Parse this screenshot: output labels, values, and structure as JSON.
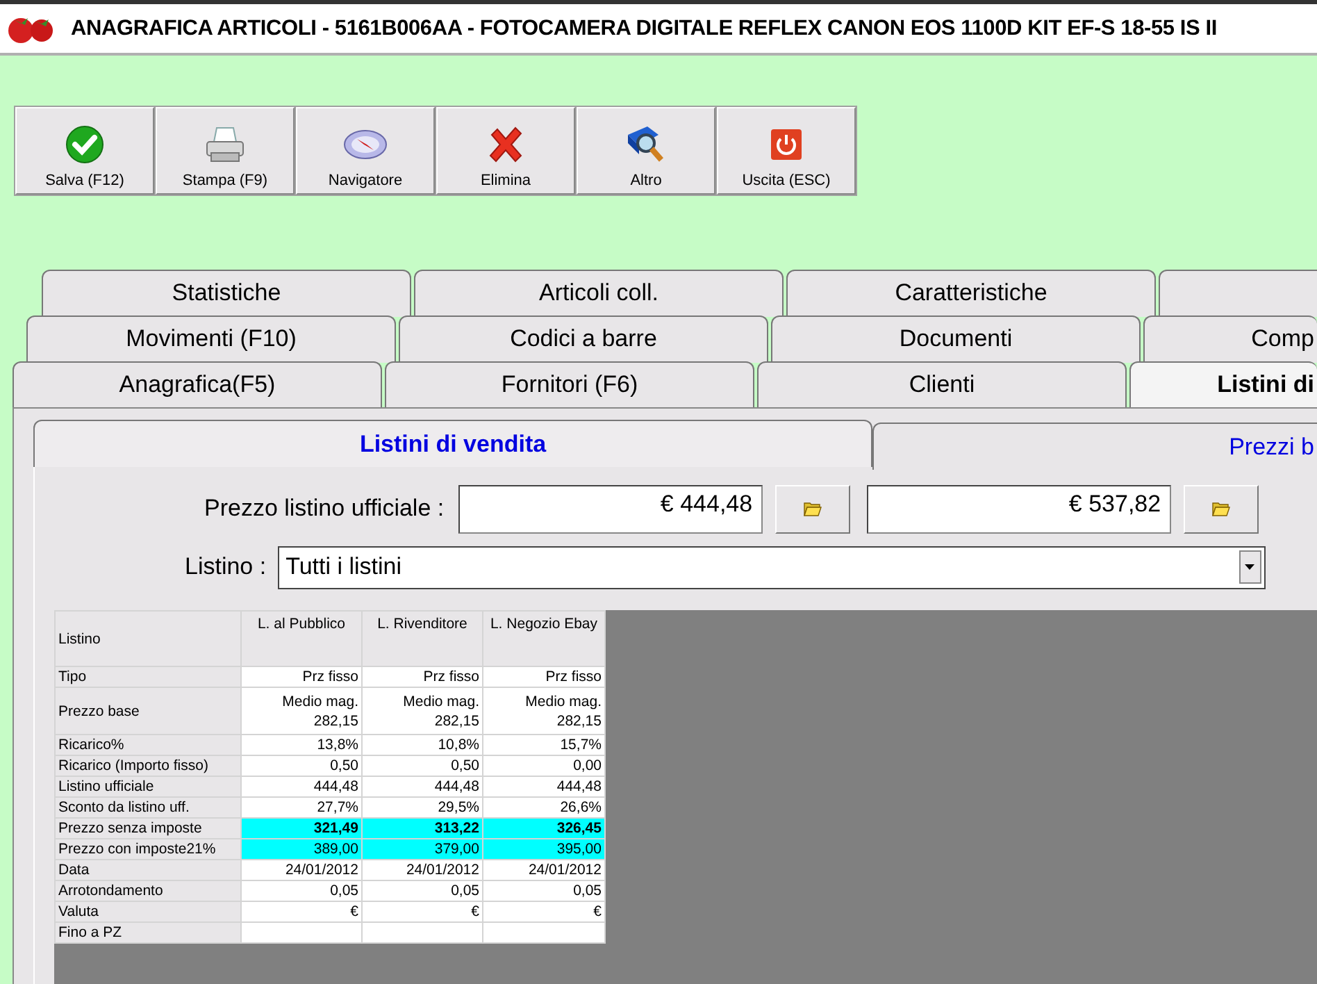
{
  "window": {
    "title": "ANAGRAFICA ARTICOLI - 5161B006AA - FOTOCAMERA DIGITALE REFLEX CANON EOS 1100D KIT EF-S 18-55 IS II"
  },
  "toolbar": [
    {
      "label": "Salva (F12)",
      "kind": "save"
    },
    {
      "label": "Stampa (F9)",
      "kind": "print"
    },
    {
      "label": "Navigatore",
      "kind": "navigate"
    },
    {
      "label": "Elimina",
      "kind": "delete"
    },
    {
      "label": "Altro",
      "kind": "more"
    },
    {
      "label": "Uscita (ESC)",
      "kind": "exit"
    }
  ],
  "tab_rows": [
    {
      "tabs": [
        {
          "label": "Statistiche",
          "selected": false
        },
        {
          "label": "Articoli coll.",
          "selected": false
        },
        {
          "label": "Caratteristiche",
          "selected": false
        }
      ]
    },
    {
      "tabs": [
        {
          "label": "Movimenti (F10)",
          "selected": false
        },
        {
          "label": "Codici a barre",
          "selected": false
        },
        {
          "label": "Documenti",
          "selected": false
        },
        {
          "label": "Comp",
          "selected": false
        }
      ]
    },
    {
      "tabs": [
        {
          "label": "Anagrafica(F5)",
          "selected": false
        },
        {
          "label": "Fornitori (F6)",
          "selected": false
        },
        {
          "label": "Clienti",
          "selected": false
        },
        {
          "label": "Listini di",
          "selected": true
        }
      ]
    }
  ],
  "subtabs": [
    {
      "label": "Listini di vendita",
      "selected": true
    },
    {
      "label": "Prezzi b",
      "selected": false
    }
  ],
  "official_price": {
    "label": "Prezzo listino ufficiale :",
    "values": [
      "€ 444,48",
      "€ 537,82"
    ]
  },
  "listino": {
    "label": "Listino :",
    "value": "Tutti i listini"
  },
  "table": {
    "columns": [
      "Listino",
      "L. al Pubblico",
      "L. Rivenditore",
      "L. Negozio Ebay"
    ],
    "rows": [
      {
        "label": "Tipo",
        "cells": [
          "Prz fisso",
          "Prz fisso",
          "Prz fisso"
        ],
        "highlighted": false,
        "bold": false
      },
      {
        "label": "Prezzo base",
        "cells": [
          "Medio mag.\n282,15",
          "Medio mag.\n282,15",
          "Medio mag.\n282,15"
        ],
        "highlighted": false,
        "bold": false
      },
      {
        "label": "Ricarico%",
        "cells": [
          "13,8%",
          "10,8%",
          "15,7%"
        ],
        "highlighted": false,
        "bold": false
      },
      {
        "label": "Ricarico (Importo fisso)",
        "cells": [
          "0,50",
          "0,50",
          "0,00"
        ],
        "highlighted": false,
        "bold": false
      },
      {
        "label": "Listino ufficiale",
        "cells": [
          "444,48",
          "444,48",
          "444,48"
        ],
        "highlighted": false,
        "bold": false
      },
      {
        "label": "Sconto da listino uff.",
        "cells": [
          "27,7%",
          "29,5%",
          "26,6%"
        ],
        "highlighted": false,
        "bold": false
      },
      {
        "label": "Prezzo senza imposte",
        "cells": [
          "321,49",
          "313,22",
          "326,45"
        ],
        "highlighted": true,
        "bold": true
      },
      {
        "label": "Prezzo con imposte21%",
        "cells": [
          "389,00",
          "379,00",
          "395,00"
        ],
        "highlighted": true,
        "bold": false
      },
      {
        "label": "Data",
        "cells": [
          "24/01/2012",
          "24/01/2012",
          "24/01/2012"
        ],
        "highlighted": false,
        "bold": false
      },
      {
        "label": "Arrotondamento",
        "cells": [
          "0,05",
          "0,05",
          "0,05"
        ],
        "highlighted": false,
        "bold": false
      },
      {
        "label": "Valuta",
        "cells": [
          "€",
          "€",
          "€"
        ],
        "highlighted": false,
        "bold": false
      },
      {
        "label": "Fino a PZ",
        "highlighted": false
      }
    ]
  }
}
